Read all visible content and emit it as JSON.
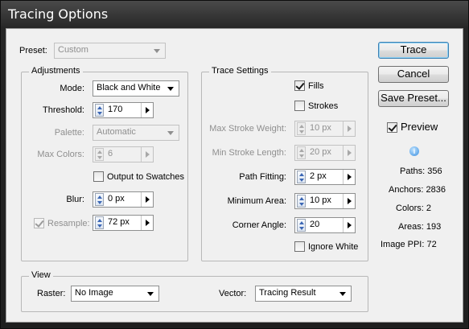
{
  "window": {
    "title": "Tracing Options"
  },
  "preset": {
    "label": "Preset:",
    "value": "Custom"
  },
  "adjustments": {
    "title": "Adjustments",
    "mode": {
      "label": "Mode:",
      "value": "Black and White"
    },
    "threshold": {
      "label": "Threshold:",
      "value": "170"
    },
    "palette": {
      "label": "Palette:",
      "value": "Automatic"
    },
    "max_colors": {
      "label": "Max Colors:",
      "value": "6"
    },
    "output_to_swatches": {
      "label": "Output to Swatches",
      "checked": false
    },
    "blur": {
      "label": "Blur:",
      "value": "0 px"
    },
    "resample": {
      "label": "Resample:",
      "value": "72 px",
      "checked": true
    }
  },
  "trace_settings": {
    "title": "Trace Settings",
    "fills": {
      "label": "Fills",
      "checked": true
    },
    "strokes": {
      "label": "Strokes",
      "checked": false
    },
    "max_stroke_weight": {
      "label": "Max Stroke Weight:",
      "value": "10 px"
    },
    "min_stroke_length": {
      "label": "Min Stroke Length:",
      "value": "20 px"
    },
    "path_fitting": {
      "label": "Path Fitting:",
      "value": "2 px"
    },
    "minimum_area": {
      "label": "Minimum Area:",
      "value": "10 px"
    },
    "corner_angle": {
      "label": "Corner Angle:",
      "value": "20"
    },
    "ignore_white": {
      "label": "Ignore White",
      "checked": false
    }
  },
  "view": {
    "title": "View",
    "raster": {
      "label": "Raster:",
      "value": "No Image"
    },
    "vector": {
      "label": "Vector:",
      "value": "Tracing Result"
    }
  },
  "buttons": {
    "trace": "Trace",
    "cancel": "Cancel",
    "save_preset": "Save Preset..."
  },
  "preview": {
    "label": "Preview",
    "checked": true
  },
  "stats": {
    "paths": "Paths: 356",
    "anchors": "Anchors: 2836",
    "colors": "Colors: 2",
    "areas": "Areas: 193",
    "image_ppi": "Image PPI: 72"
  },
  "icons": {
    "info": "info-icon"
  },
  "colors": {
    "default_button_border": "#3c7fb1",
    "client_bg": "#f0f0f0"
  }
}
